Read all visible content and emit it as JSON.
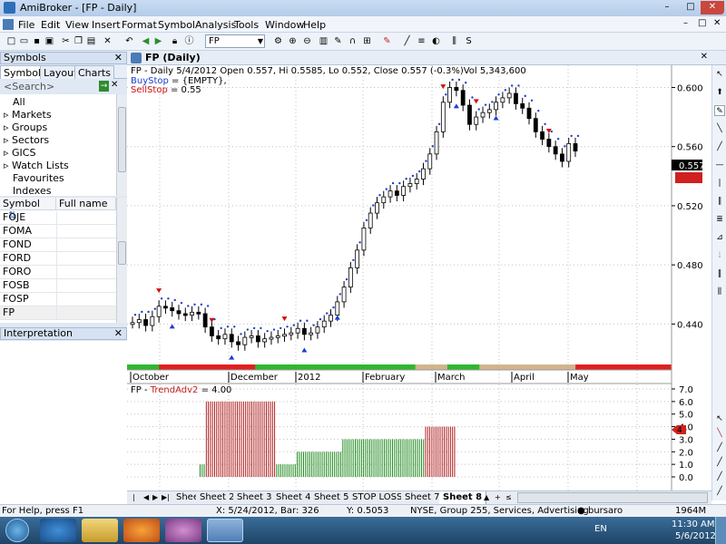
{
  "window": {
    "title": "AmiBroker - [FP - Daily]",
    "controls": [
      "–",
      "□",
      "✕"
    ]
  },
  "menu": {
    "items": [
      "File",
      "Edit",
      "View",
      "Insert",
      "Format",
      "Symbol",
      "Analysis",
      "Tools",
      "Window",
      "Help"
    ],
    "mdi_controls": [
      "–",
      "□",
      "✕"
    ]
  },
  "toolbar": {
    "symbol_value": "FP"
  },
  "symbols_panel": {
    "header": "Symbols",
    "tabs": [
      "Symbols",
      "Layouts",
      "Charts"
    ],
    "search_placeholder": "<Search>",
    "tree": [
      "All",
      "Markets",
      "Groups",
      "Sectors",
      "GICS",
      "Watch Lists",
      "Favourites",
      "Indexes"
    ],
    "columns": [
      "Symbol",
      "Full name"
    ],
    "rows": [
      "FOJE",
      "FOMA",
      "FOND",
      "FORD",
      "FORO",
      "FOSB",
      "FOSP",
      "FP"
    ]
  },
  "interpretation_panel": {
    "header": "Interpretation"
  },
  "chart_window": {
    "title": "FP (Daily)",
    "info_line": "FP - Daily 5/4/2012 Open 0.557, Hi 0.5585, Lo 0.552, Close 0.557 (-0.3%)Vol 5,343,600",
    "buystop_label": "BuyStop",
    "buystop_value": " = {EMPTY},",
    "sellstop_label": "SellStop",
    "sellstop_value": " = 0.55",
    "price_ticks": [
      "0.600",
      "0.560",
      "0.520",
      "0.480",
      "0.440"
    ],
    "last_price_tag": "0.557",
    "date_labels": [
      "October",
      "December",
      "2012",
      "February",
      "March",
      "April",
      "May"
    ],
    "lower_title_prefix": "FP - ",
    "lower_title_name": "TrendAdv2",
    "lower_title_value": " = 4.00",
    "lower_ticks": [
      "7.0",
      "6.0",
      "5.0",
      "4.0",
      "3.0",
      "2.0",
      "1.0",
      "0.0"
    ],
    "lower_tag": "4",
    "colors": {
      "up": "#2eb82e",
      "down": "#e02020",
      "neutral": "#d2b48c",
      "buy_arrow": "#1a3fd0",
      "sell_arrow": "#d01010"
    }
  },
  "chart_data": [
    {
      "type": "candlestick",
      "title": "FP - Daily",
      "ylim": [
        0.42,
        0.615
      ],
      "x_labels": [
        "October",
        "December",
        "2012",
        "February",
        "March",
        "April",
        "May"
      ],
      "close_series": [
        0.441,
        0.443,
        0.439,
        0.445,
        0.452,
        0.451,
        0.449,
        0.447,
        0.446,
        0.448,
        0.447,
        0.438,
        0.432,
        0.43,
        0.433,
        0.428,
        0.426,
        0.431,
        0.432,
        0.428,
        0.43,
        0.431,
        0.432,
        0.433,
        0.434,
        0.437,
        0.433,
        0.434,
        0.438,
        0.442,
        0.446,
        0.455,
        0.465,
        0.478,
        0.49,
        0.505,
        0.515,
        0.522,
        0.526,
        0.53,
        0.527,
        0.533,
        0.535,
        0.538,
        0.545,
        0.555,
        0.57,
        0.59,
        0.6,
        0.598,
        0.588,
        0.575,
        0.58,
        0.583,
        0.585,
        0.59,
        0.593,
        0.596,
        0.589,
        0.586,
        0.579,
        0.57,
        0.565,
        0.56,
        0.555,
        0.55,
        0.562,
        0.557
      ],
      "trend_bars": [
        "up",
        "down",
        "down",
        "down",
        "up",
        "up",
        "up",
        "up",
        "up",
        "neutral",
        "up",
        "neutral",
        "neutral",
        "neutral",
        "down",
        "down",
        "down"
      ]
    },
    {
      "type": "bar",
      "title": "TrendAdv2",
      "ylim": [
        0,
        7
      ],
      "segments": [
        {
          "value": 1,
          "color": "green",
          "count": 3
        },
        {
          "value": 6,
          "color": "red",
          "count": 34
        },
        {
          "value": 1,
          "color": "green",
          "count": 10
        },
        {
          "value": 2,
          "color": "green",
          "count": 22
        },
        {
          "value": 3,
          "color": "green",
          "count": 40
        },
        {
          "value": 4,
          "color": "red",
          "count": 15
        }
      ]
    }
  ],
  "sheets": {
    "tabs": [
      "Sheet 1",
      "Sheet 2",
      "Sheet 3",
      "Sheet 4",
      "Sheet 5",
      "STOP LOSS",
      "Sheet 7",
      "Sheet 8"
    ],
    "active": "Sheet 8",
    "extras": [
      "▲",
      "+",
      "≤"
    ]
  },
  "status": {
    "help": "For Help, press F1",
    "x": "X: 5/24/2012, Bar: 326",
    "y": "Y: 0.5053",
    "info": "NYSE, Group 255, Services, Advertising",
    "user": "bursaro",
    "mem": "1964M"
  },
  "taskbar": {
    "lang": "EN",
    "time": "11:30 AM",
    "date": "5/6/2012"
  }
}
